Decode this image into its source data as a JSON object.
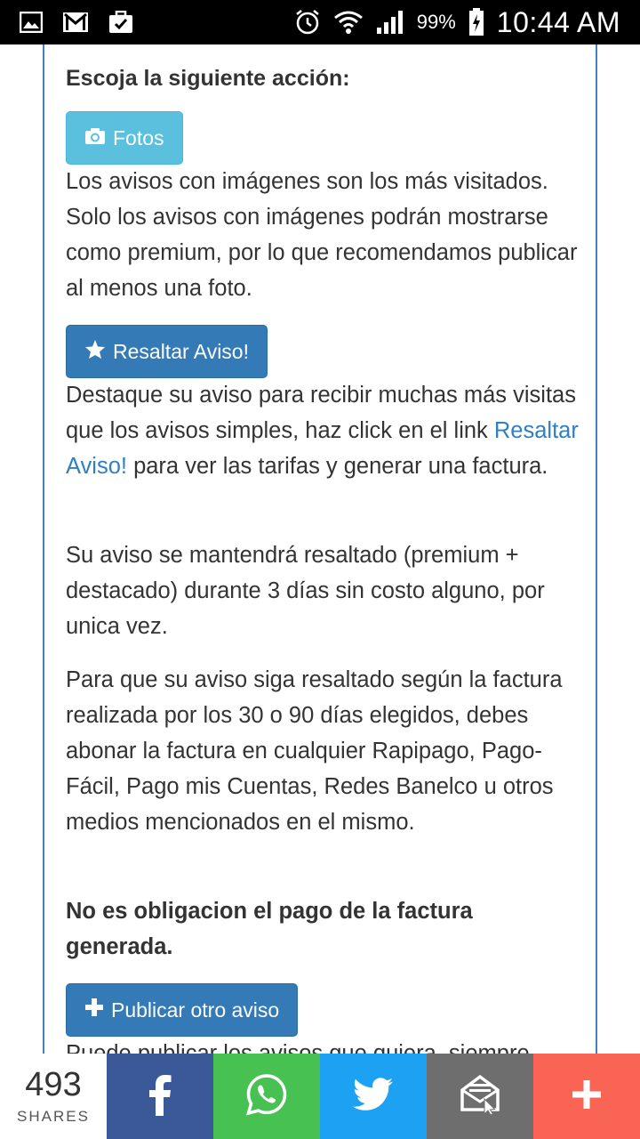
{
  "status_bar": {
    "battery": "99%",
    "time": "10:44 AM"
  },
  "content": {
    "heading": "Escoja la siguiente acción:",
    "fotos_button": "Fotos",
    "fotos_text": "Los avisos con imágenes son los más visitados. Solo los avisos con imágenes podrán mostrarse como premium, por lo que recomendamos publicar al menos una foto.",
    "resaltar_button": "Resaltar Aviso!",
    "resaltar_text_before": "Destaque su aviso para recibir muchas más visitas que los avisos simples, haz click en el link ",
    "resaltar_link": "Resaltar Aviso!",
    "resaltar_text_after": " para ver las tarifas y generar una factura.",
    "resaltado_text": "Su aviso se mantendrá resaltado (premium + destacado) durante 3 días sin costo alguno, por unica vez.",
    "factura_text": "Para que su aviso siga resaltado según la factura realizada por los 30 o 90 días elegidos, debes abonar la factura en cualquier Rapipago, Pago-Fácil, Pago mis Cuentas, Redes Banelco u otros medios mencionados en el mismo.",
    "obligacion_text": "No es obligacion el pago de la factura generada.",
    "publicar_button": "Publicar otro aviso",
    "publicar_text": "Puede publicar los avisos que quiera, siempre"
  },
  "share_bar": {
    "count": "493",
    "label": "SHARES"
  },
  "colors": {
    "info": "#5bc0de",
    "primary": "#337ab7",
    "link": "#2f7fc4",
    "facebook": "#3b5998",
    "whatsapp": "#47c252",
    "twitter": "#1da1f2",
    "email": "#6e6e6e",
    "more": "#fa6454"
  }
}
